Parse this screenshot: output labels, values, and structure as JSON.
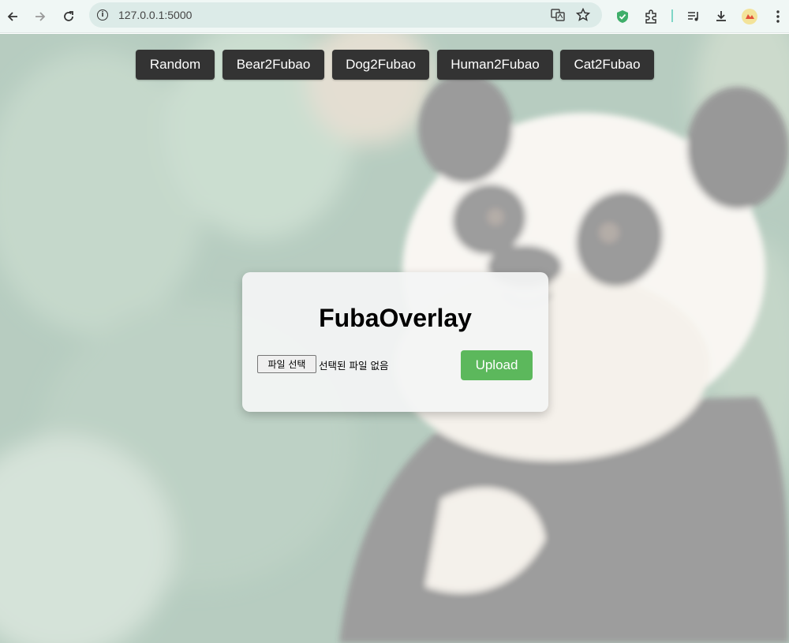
{
  "browser": {
    "url": "127.0.0.1:5000",
    "icons": [
      "back-icon",
      "forward-icon",
      "reload-icon",
      "site-info-icon",
      "translate-icon",
      "bookmark-star-icon",
      "shield-check-icon",
      "extensions-icon",
      "media-queue-icon",
      "download-icon",
      "profile-icon",
      "menu-icon"
    ]
  },
  "nav": {
    "buttons": [
      {
        "label": "Random"
      },
      {
        "label": "Bear2Fubao"
      },
      {
        "label": "Dog2Fubao"
      },
      {
        "label": "Human2Fubao"
      },
      {
        "label": "Cat2Fubao"
      }
    ]
  },
  "upload_card": {
    "title": "FubaOverlay",
    "file_button_label": "파일 선택",
    "file_status": "선택된 파일 없음",
    "upload_label": "Upload"
  },
  "colors": {
    "nav_button_bg": "#333333",
    "upload_button_bg": "#5cb85c",
    "chrome_bg": "#f0f7f5"
  }
}
